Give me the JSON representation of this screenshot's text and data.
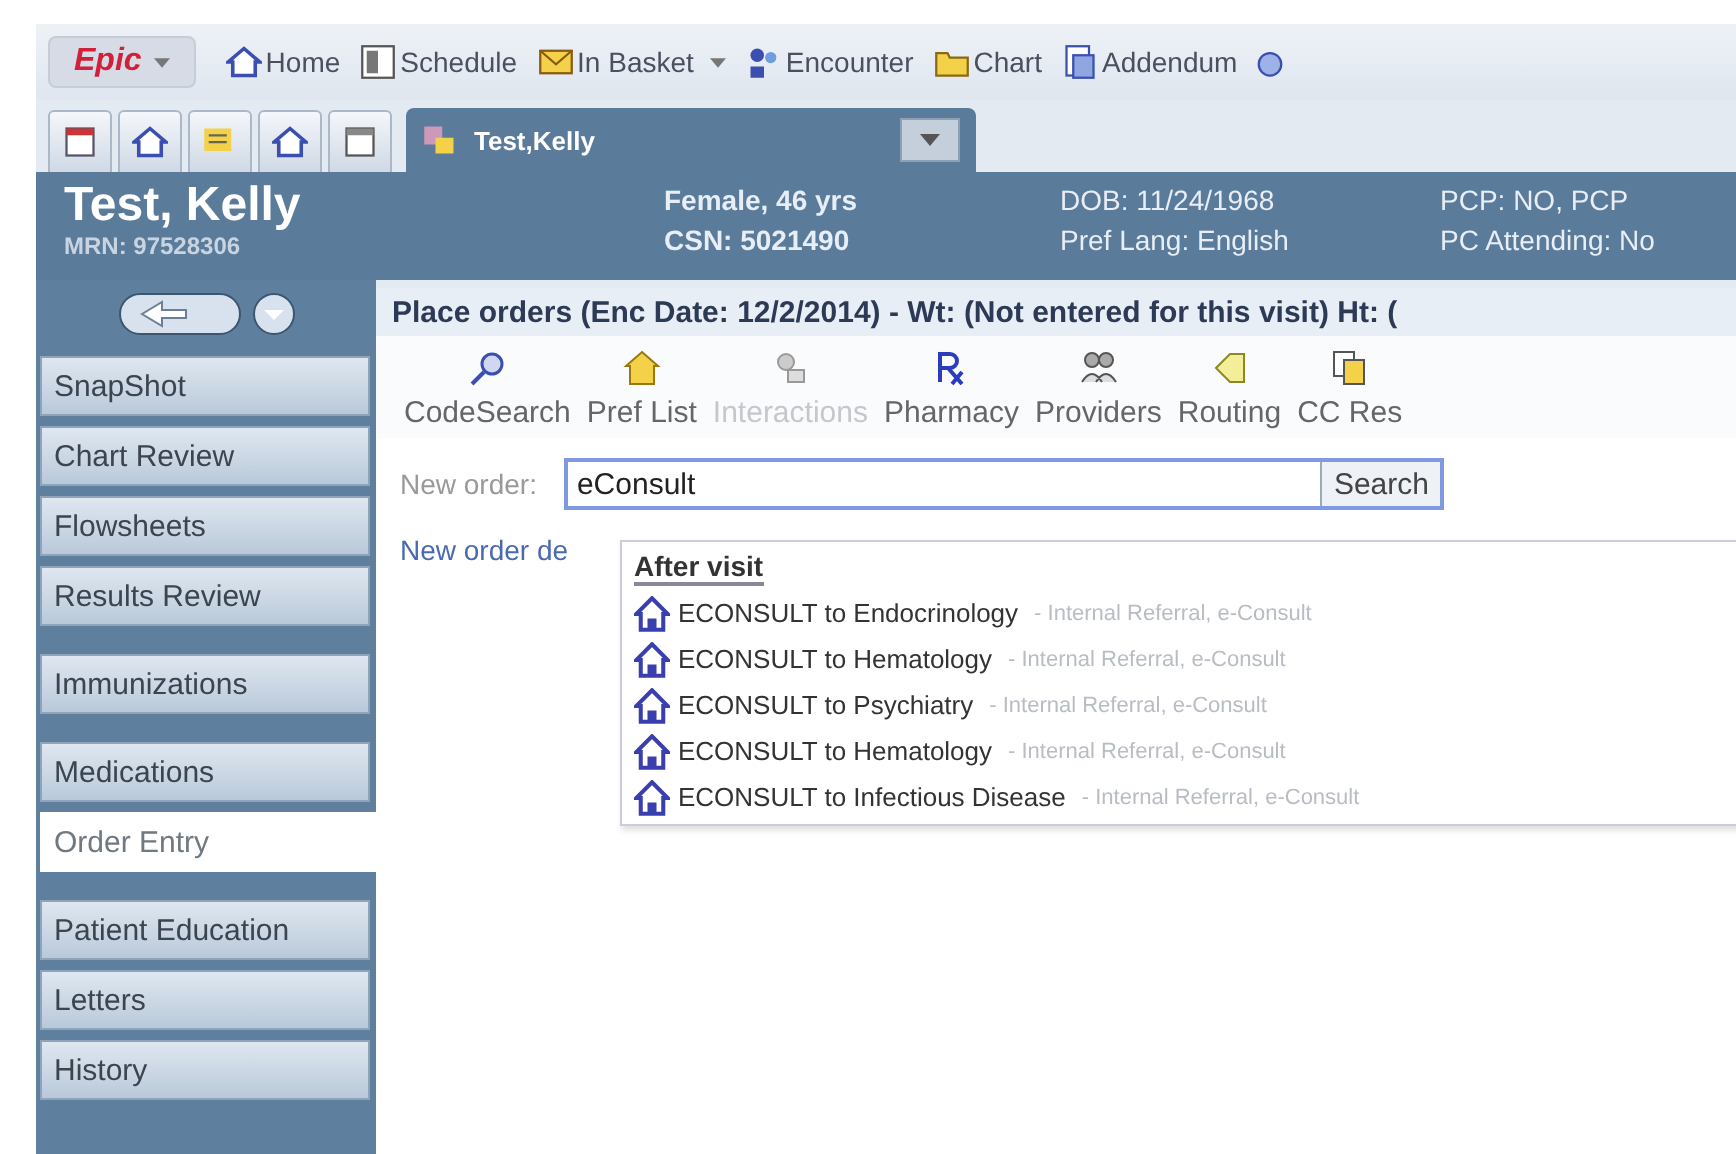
{
  "top_toolbar": {
    "logo": {
      "label": "Epic",
      "has_menu": true
    },
    "items": [
      {
        "label": "Home",
        "kind": "home",
        "has_menu": false
      },
      {
        "label": "Schedule",
        "kind": "schedule",
        "has_menu": false
      },
      {
        "label": "In Basket",
        "kind": "inbasket",
        "has_menu": true
      },
      {
        "label": "Encounter",
        "kind": "encounter",
        "has_menu": false
      },
      {
        "label": "Chart",
        "kind": "chart",
        "has_menu": false
      },
      {
        "label": "Addendum",
        "kind": "addendum",
        "has_menu": false
      }
    ]
  },
  "patient_tab": {
    "label": "Test,Kelly"
  },
  "patient_header": {
    "name": "Test, Kelly",
    "mrn": "MRN: 97528306",
    "columns": [
      [
        "Female, 46 yrs",
        "CSN: 5021490"
      ],
      [
        "DOB: 11/24/1968",
        "Pref Lang: English"
      ],
      [
        "PCP: NO, PCP",
        "PC Attending: No"
      ]
    ]
  },
  "sidebar": {
    "groups": [
      [
        {
          "label": "SnapShot",
          "selected": false
        },
        {
          "label": "Chart Review",
          "selected": false
        },
        {
          "label": "Flowsheets",
          "selected": false
        },
        {
          "label": "Results Review",
          "selected": false
        }
      ],
      [
        {
          "label": "Immunizations",
          "selected": false
        }
      ],
      [
        {
          "label": "Medications",
          "selected": false
        },
        {
          "label": "Order Entry",
          "selected": true
        }
      ],
      [
        {
          "label": "Patient Education",
          "selected": false
        },
        {
          "label": "Letters",
          "selected": false
        },
        {
          "label": "History",
          "selected": false
        }
      ]
    ]
  },
  "panel": {
    "title": "Place orders (Enc Date: 12/2/2014) - Wt: (Not entered for this visit) Ht: (",
    "toolbar": [
      {
        "label": "CodeSearch",
        "kind": "search",
        "disabled": false
      },
      {
        "label": "Pref List",
        "kind": "preflist",
        "disabled": false
      },
      {
        "label": "Interactions",
        "kind": "interactions",
        "disabled": true
      },
      {
        "label": "Pharmacy",
        "kind": "rx",
        "disabled": false
      },
      {
        "label": "Providers",
        "kind": "providers",
        "disabled": false
      },
      {
        "label": "Routing",
        "kind": "routing",
        "disabled": false
      },
      {
        "label": "CC Res",
        "kind": "cc",
        "disabled": false
      }
    ],
    "new_order": {
      "label": "New order:",
      "value": "eConsult",
      "button": "Search"
    },
    "link": "New order de",
    "dropdown": {
      "heading": "After visit",
      "items": [
        {
          "name": "ECONSULT to Endocrinology",
          "detail": "- Internal Referral, e-Consult"
        },
        {
          "name": "ECONSULT to Hematology",
          "detail": "- Internal Referral, e-Consult"
        },
        {
          "name": "ECONSULT to Psychiatry",
          "detail": "- Internal Referral, e-Consult"
        },
        {
          "name": "ECONSULT to Hematology",
          "detail": "- Internal Referral, e-Consult"
        },
        {
          "name": "ECONSULT to Infectious Disease",
          "detail": "- Internal Referral, e-Consult"
        }
      ]
    }
  }
}
